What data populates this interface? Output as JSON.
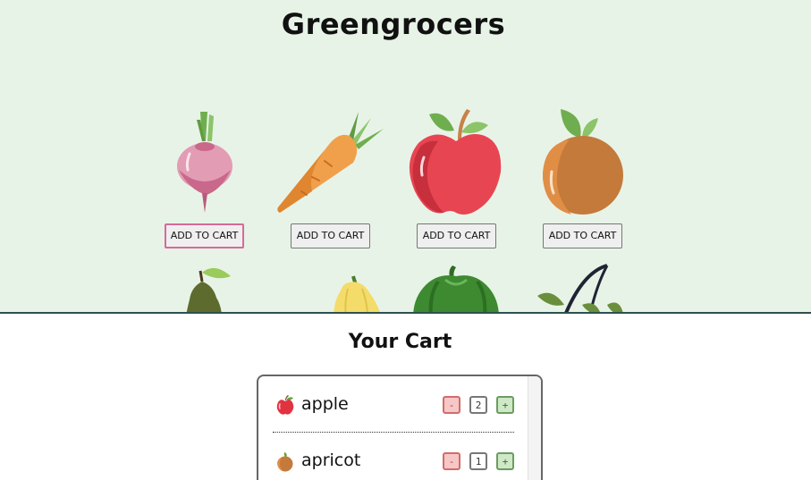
{
  "header": {
    "title": "Greengrocers"
  },
  "products": [
    {
      "name": "beetroot",
      "icon": "beetroot-icon",
      "button_label": "ADD TO CART"
    },
    {
      "name": "carrot",
      "icon": "carrot-icon",
      "button_label": "ADD TO CART"
    },
    {
      "name": "apple",
      "icon": "apple-icon",
      "button_label": "ADD TO CART"
    },
    {
      "name": "apricot",
      "icon": "apricot-icon",
      "button_label": "ADD TO CART"
    }
  ],
  "partial_products": [
    {
      "icon": "avocado-icon"
    },
    {
      "icon": "squash-icon"
    },
    {
      "icon": "pepper-icon"
    },
    {
      "icon": "eggplant-icon"
    }
  ],
  "cart": {
    "title": "Your Cart",
    "items": [
      {
        "name": "apple",
        "icon": "apple-icon",
        "minus_label": "-",
        "quantity": "2",
        "plus_label": "+"
      },
      {
        "name": "apricot",
        "icon": "apricot-icon",
        "minus_label": "-",
        "quantity": "1",
        "plus_label": "+"
      }
    ]
  },
  "colors": {
    "top_background": "#e8f3e8",
    "divider": "#2f4f4f",
    "minus_accent": "#d46b6b",
    "plus_accent": "#6b9d5e",
    "active_button_border": "#d46a9a"
  }
}
